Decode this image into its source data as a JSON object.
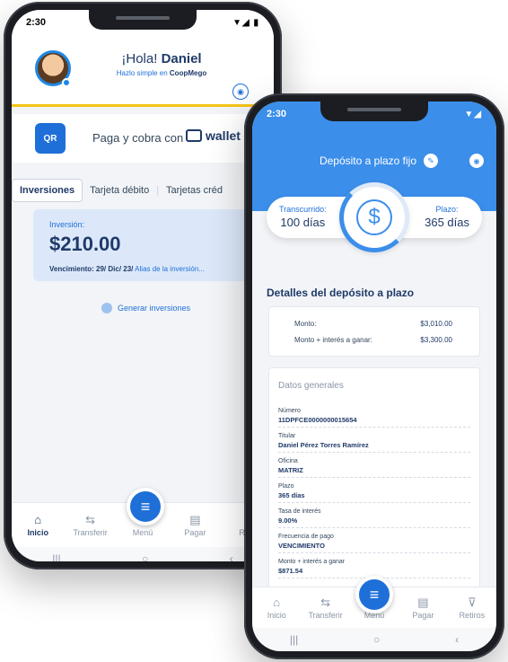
{
  "phone1": {
    "time": "2:30",
    "signal": "▼◢ ▮",
    "greeting_prefix": "¡Hola!",
    "user_name": "Daniel",
    "tagline_prefix": "Hazlo simple en",
    "brand": "CoopMego",
    "wallet_text": "Paga y cobra con",
    "wallet_brand": "wallet",
    "qr_label": "QR",
    "tabs": [
      "Inversiones",
      "Tarjeta débito",
      "Tarjetas créd"
    ],
    "investment": {
      "label": "Inversión:",
      "amount": "$210.00",
      "due_label": "Vencimiento:",
      "due_value": "29/ Dic/ 23/",
      "alias": "Alias de la inversión..."
    },
    "generate_label": "Generar inversiones",
    "nav": [
      "Inicio",
      "Transferir",
      "Menú",
      "Pagar",
      "Retir"
    ]
  },
  "phone2": {
    "time": "2:30",
    "signal": "▼◢",
    "title": "Depósito a plazo fijo",
    "elapsed_label": "Transcurrido:",
    "elapsed_value": "100 días",
    "term_label": "Plazo:",
    "term_value": "365 días",
    "dial_symbol": "$",
    "details_title": "Detalles del depósito a plazo",
    "amount_label": "Monto:",
    "amount_value": "$3,010.00",
    "amount_interest_label": "Monto + interés a ganar:",
    "amount_interest_value": "$3,300.00",
    "general_title": "Datos generales",
    "fields": [
      {
        "label": "Número",
        "value": "11DPFCE0000000015654"
      },
      {
        "label": "Titular",
        "value": "Daniel Pérez Torres Ramírez"
      },
      {
        "label": "Oficina",
        "value": "MATRIZ"
      },
      {
        "label": "Plazo",
        "value": "365 días"
      },
      {
        "label": "Tasa de interés",
        "value": "9.00%"
      },
      {
        "label": "Frecuencia de pago",
        "value": "VENCIMIENTO"
      },
      {
        "label": "Monto + interés a ganar",
        "value": "$871.54"
      }
    ],
    "nav": [
      "Inicio",
      "Transferir",
      "Menú",
      "Pagar",
      "Retiros"
    ]
  },
  "colors": {
    "primary": "#1e6fd8",
    "header_blue": "#3b8eea",
    "accent_yellow": "#f5c518",
    "navy": "#1f3a68"
  },
  "icons": [
    "home-icon",
    "transfer-icon",
    "menu-icon",
    "pay-icon",
    "withdraw-icon",
    "eye-icon",
    "edit-icon",
    "qr-icon",
    "dollar-icon",
    "plus-icon"
  ]
}
